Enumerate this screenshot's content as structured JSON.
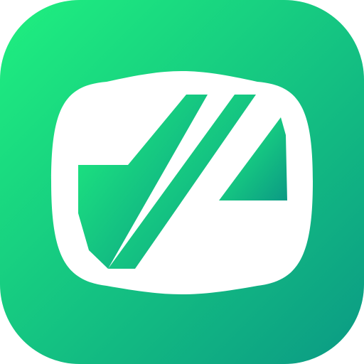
{
  "app_icon": {
    "icon": "app-logo-icon",
    "colors": {
      "gradient_start": "#1FF07F",
      "gradient_end": "#0B9A84",
      "foreground": "#FFFFFF"
    }
  }
}
